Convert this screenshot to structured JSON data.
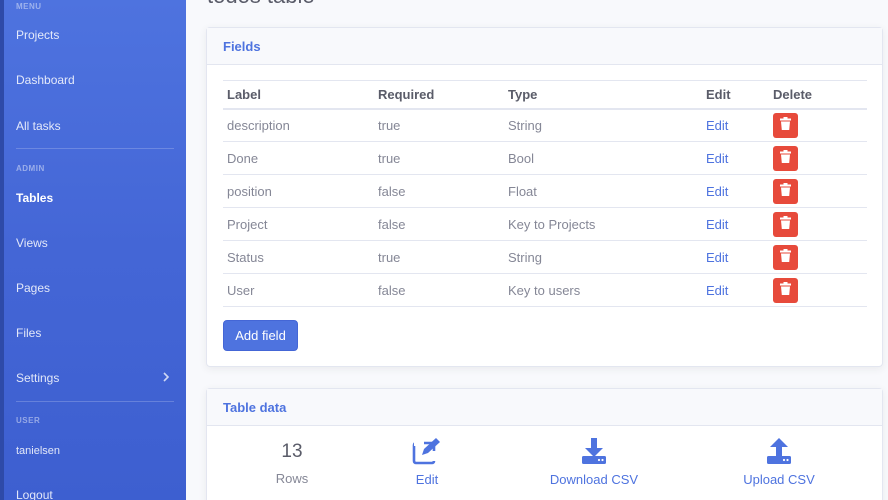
{
  "page_title": "todos table",
  "sidebar": {
    "menu_heading": "MENU",
    "menu_items": [
      {
        "label": "Projects"
      },
      {
        "label": "Dashboard"
      },
      {
        "label": "All tasks"
      }
    ],
    "admin_heading": "ADMIN",
    "admin_items": [
      {
        "label": "Tables"
      },
      {
        "label": "Views"
      },
      {
        "label": "Pages"
      },
      {
        "label": "Files"
      },
      {
        "label": "Settings"
      }
    ],
    "user_heading": "USER",
    "user_items": [
      {
        "label": "tanielsen"
      },
      {
        "label": "Logout"
      }
    ],
    "active": "Tables"
  },
  "fields_card": {
    "title": "Fields",
    "columns": [
      "Label",
      "Required",
      "Type",
      "Edit",
      "Delete"
    ],
    "rows": [
      {
        "label": "description",
        "required": "true",
        "type": "String",
        "edit": "Edit"
      },
      {
        "label": "Done",
        "required": "true",
        "type": "Bool",
        "edit": "Edit"
      },
      {
        "label": "position",
        "required": "false",
        "type": "Float",
        "edit": "Edit"
      },
      {
        "label": "Project",
        "required": "false",
        "type": "Key to Projects",
        "edit": "Edit"
      },
      {
        "label": "Status",
        "required": "true",
        "type": "String",
        "edit": "Edit"
      },
      {
        "label": "User",
        "required": "false",
        "type": "Key to users",
        "edit": "Edit"
      }
    ],
    "add_button": "Add field"
  },
  "table_data_card": {
    "title": "Table data",
    "rows_count": "13",
    "rows_label": "Rows",
    "edit_label": "Edit",
    "download_label": "Download CSV",
    "upload_label": "Upload CSV"
  },
  "colors": {
    "primary": "#4e73df",
    "danger": "#e74a3b",
    "sidebar": "#4e73df"
  }
}
